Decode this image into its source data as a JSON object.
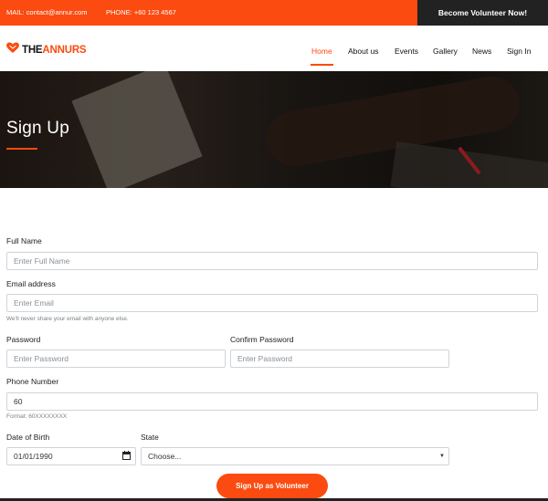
{
  "topbar": {
    "mail": "MAIL: contact@annur.com",
    "phone": "PHONE: +60 123 4567",
    "volunteer_label": "Become Volunteer Now!"
  },
  "logo": {
    "part1": "THE",
    "part2": "ANNURS",
    "icon": "heart-icon"
  },
  "nav": {
    "items": [
      {
        "label": "Home",
        "active": true
      },
      {
        "label": "About us"
      },
      {
        "label": "Events"
      },
      {
        "label": "Gallery"
      },
      {
        "label": "News"
      },
      {
        "label": "Sign In"
      }
    ]
  },
  "hero": {
    "title": "Sign Up"
  },
  "form": {
    "full_name": {
      "label": "Full Name",
      "placeholder": "Enter Full Name"
    },
    "email": {
      "label": "Email address",
      "placeholder": "Enter Email",
      "hint": "We'll never share your email with anyone else."
    },
    "password": {
      "label": "Password",
      "placeholder": "Enter Password"
    },
    "confirm_password": {
      "label": "Confirm Password",
      "placeholder": "Enter Password"
    },
    "phone": {
      "label": "Phone Number",
      "value": "60",
      "hint": "Format: 60XXXXXXXX"
    },
    "dob": {
      "label": "Date of Birth",
      "value": "01/01/1990",
      "icon": "calendar-icon"
    },
    "state": {
      "label": "State",
      "selected": "Choose...",
      "icon": "chevron-down-icon"
    },
    "submit_label": "Sign Up as Volunteer"
  },
  "colors": {
    "accent": "#fb4b10",
    "dark": "#222222"
  }
}
